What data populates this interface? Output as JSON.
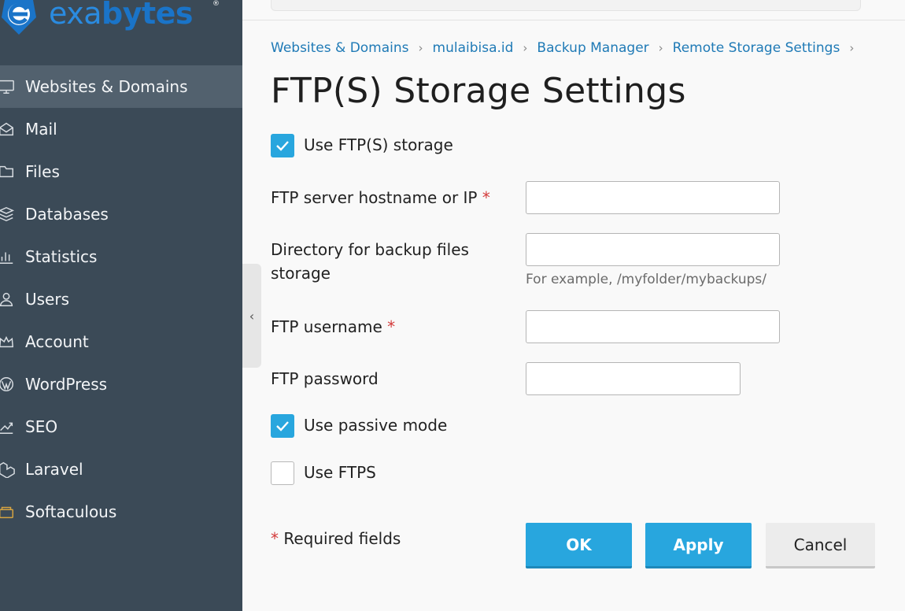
{
  "brand": {
    "logo_text_a": "exa",
    "logo_text_b": "bytes",
    "logo_reg": "®",
    "accent": "#1a74c8"
  },
  "sidebar": {
    "items": [
      {
        "label": "Websites & Domains",
        "icon": "monitor-icon",
        "active": true
      },
      {
        "label": "Mail",
        "icon": "mail-icon"
      },
      {
        "label": "Files",
        "icon": "folder-icon"
      },
      {
        "label": "Databases",
        "icon": "database-icon"
      },
      {
        "label": "Statistics",
        "icon": "statistics-icon"
      },
      {
        "label": "Users",
        "icon": "user-icon"
      },
      {
        "label": "Account",
        "icon": "crown-icon"
      },
      {
        "label": "WordPress",
        "icon": "wordpress-icon"
      },
      {
        "label": "SEO",
        "icon": "seo-chart-icon"
      },
      {
        "label": "Laravel",
        "icon": "laravel-icon"
      },
      {
        "label": "Softaculous",
        "icon": "softaculous-icon"
      }
    ],
    "collapse_glyph": "‹"
  },
  "breadcrumb": [
    "Websites & Domains",
    "mulaibisa.id",
    "Backup Manager",
    "Remote Storage Settings"
  ],
  "breadcrumb_sep": "›",
  "page": {
    "title": "FTP(S) Storage Settings"
  },
  "form": {
    "use_ftp_label": "Use FTP(S) storage",
    "use_ftp_checked": true,
    "hostname_label": "FTP server hostname or IP",
    "hostname_value": "",
    "directory_label_line1": "Directory for backup files",
    "directory_label_line2": "storage",
    "directory_value": "",
    "directory_hint": "For example, /myfolder/mybackups/",
    "username_label": "FTP username",
    "username_value": "",
    "password_label": "FTP password",
    "password_value": "",
    "passive_label": "Use passive mode",
    "passive_checked": true,
    "ftps_label": "Use FTPS",
    "ftps_checked": false,
    "required_star": "*",
    "required_note": "Required fields"
  },
  "buttons": {
    "ok": "OK",
    "apply": "Apply",
    "cancel": "Cancel"
  },
  "colors": {
    "sidebar_bg": "#3b4a57",
    "sidebar_active": "#52616e",
    "primary_button": "#28a6de",
    "link": "#1f7ab6",
    "required": "#d33a3a"
  }
}
